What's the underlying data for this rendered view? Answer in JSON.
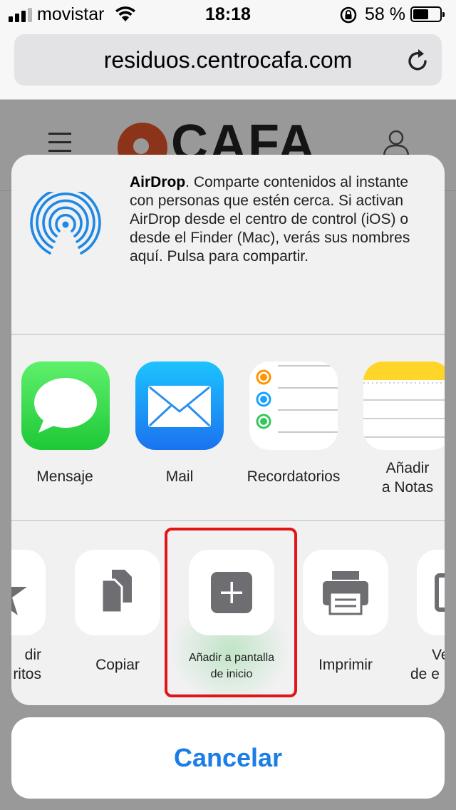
{
  "status_bar": {
    "carrier": "movistar",
    "time": "18:18",
    "battery_percent": "58 %",
    "battery_level": 0.58
  },
  "browser": {
    "url": "residuos.centrocafa.com"
  },
  "page": {
    "logo_text": "CAFA"
  },
  "airdrop": {
    "title": "AirDrop",
    "description": ". Comparte contenidos al instante con personas que estén cerca. Si activan AirDrop desde el centro de control (iOS) o desde el Finder (Mac), verás sus nombres aquí. Pulsa para compartir."
  },
  "apps": [
    {
      "label": "Mensaje"
    },
    {
      "label": "Mail"
    },
    {
      "label": "Recordatorios"
    },
    {
      "label_line1": "Añadir",
      "label_line2": "a Notas"
    }
  ],
  "actions": [
    {
      "label_line1": "dir",
      "label_line2": "ritos"
    },
    {
      "label": "Copiar"
    },
    {
      "label_line1": "Añadir a pantalla",
      "label_line2": "de inicio"
    },
    {
      "label": "Imprimir"
    },
    {
      "label_line1": "Ve",
      "label_line2": "de e"
    }
  ],
  "cancel": {
    "label": "Cancelar"
  },
  "colors": {
    "accent_blue": "#1a7ee6",
    "highlight_red": "#e01515",
    "messages_green": "#34c759",
    "mail_blue": "#1e90ff"
  }
}
